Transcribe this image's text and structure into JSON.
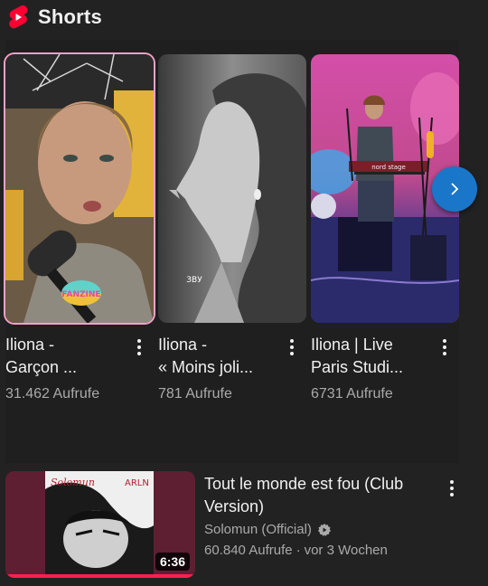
{
  "section": {
    "title": "Shorts",
    "logo_color": "#ff0033"
  },
  "shorts": [
    {
      "title_line1": "Iliona -",
      "title_line2": "Garçon ...",
      "views": "31.462 Aufrufe",
      "badge_text": "FANZINE"
    },
    {
      "title_line1": "Iliona -",
      "title_line2": "« Moins joli...",
      "views": "781 Aufrufe",
      "watermark": "ЗВУ"
    },
    {
      "title_line1": "Iliona | Live",
      "title_line2": "Paris Studi...",
      "views": "6731 Aufrufe",
      "keyboard_label": "nord stage"
    }
  ],
  "navigation": {
    "next_icon": "chevron-right-icon",
    "accent": "#1976c9"
  },
  "video": {
    "title": "Tout le monde est fou (Club Version)",
    "channel": "Solomun (Official)",
    "views": "60.840 Aufrufe",
    "separator": "·",
    "age": "vor 3 Wochen",
    "duration": "6:36",
    "progress": 1.0,
    "cover_text_left": "Solomun",
    "cover_text_right": "ARLN",
    "progress_color": "#ff1f4f"
  }
}
